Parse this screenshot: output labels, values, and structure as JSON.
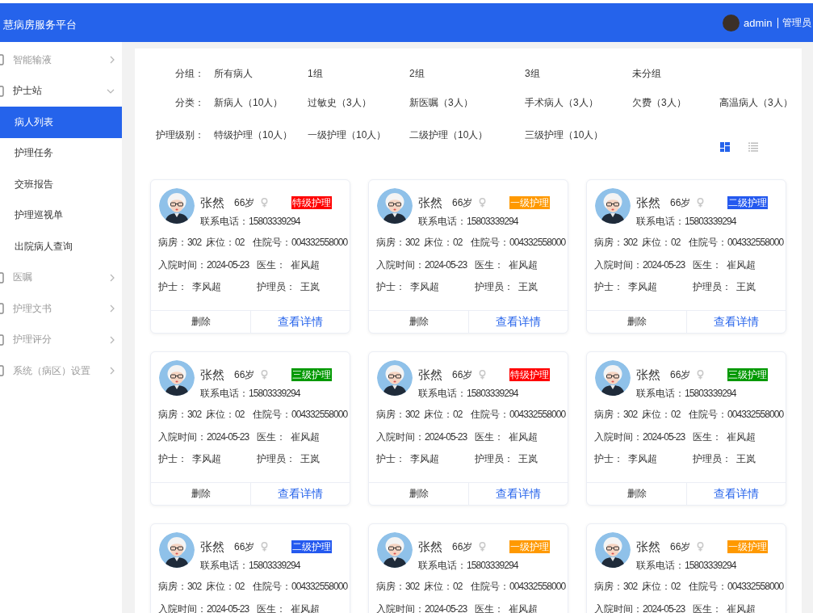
{
  "header": {
    "title": "慧病房服务平台",
    "user": "admin",
    "role": "管理员"
  },
  "sidebar": {
    "items": [
      {
        "label": "智能输液",
        "expanded": false
      },
      {
        "label": "护士站",
        "expanded": true,
        "children": [
          {
            "label": "病人列表",
            "selected": true
          },
          {
            "label": "护理任务",
            "selected": false
          },
          {
            "label": "交班报告",
            "selected": false
          },
          {
            "label": "护理巡视单",
            "selected": false
          },
          {
            "label": "出院病人查询",
            "selected": false
          }
        ]
      },
      {
        "label": "医嘱",
        "expanded": false
      },
      {
        "label": "护理文书",
        "expanded": false
      },
      {
        "label": "护理评分",
        "expanded": false
      },
      {
        "label": "系统（病区）设置",
        "expanded": false
      }
    ]
  },
  "filters": [
    {
      "label": "分组：",
      "options": [
        "所有病人",
        "1组",
        "2组",
        "3组",
        "未分组"
      ]
    },
    {
      "label": "分类：",
      "options": [
        "新病人（10人）",
        "过敏史（3人）",
        "新医嘱（3人）",
        "手术病人（3人）",
        "欠费（3人）",
        "高温病人（3人）"
      ]
    },
    {
      "label": "护理级别：",
      "options": [
        "特级护理（10人）",
        "一级护理（10人）",
        "二级护理（10人）",
        "三级护理（10人）"
      ]
    }
  ],
  "view_toggle": [
    {
      "kind": "grid",
      "selected": true
    },
    {
      "kind": "list",
      "selected": false
    }
  ],
  "cards": [
    {
      "name": "张然",
      "age": "66岁",
      "level": "特级护理",
      "color": "#ff0000",
      "phone": {
        "label": "联系电话：",
        "value": "15803339294"
      },
      "room": {
        "label": "病房：",
        "value": "302"
      },
      "bed": {
        "label": "床位：",
        "value": "02"
      },
      "admission_no": {
        "label": "住院号：",
        "value": "004332558000"
      },
      "admission_date": {
        "label": "入院时间：",
        "value": "2024-05-23"
      },
      "doctor": {
        "label": "医生：",
        "value": "崔风超"
      },
      "nurse": {
        "label": "护士：",
        "value": "李风超"
      },
      "caregiver": {
        "label": "护理员：",
        "value": "王岚"
      },
      "buttons": [
        {
          "label": "删除",
          "kind": "delete"
        },
        {
          "label": "查看详情",
          "kind": "details"
        }
      ]
    },
    {
      "name": "张然",
      "age": "66岁",
      "level": "一级护理",
      "color": "#ff9900",
      "phone": {
        "label": "联系电话：",
        "value": "15803339294"
      },
      "room": {
        "label": "病房：",
        "value": "302"
      },
      "bed": {
        "label": "床位：",
        "value": "02"
      },
      "admission_no": {
        "label": "住院号：",
        "value": "004332558000"
      },
      "admission_date": {
        "label": "入院时间：",
        "value": "2024-05-23"
      },
      "doctor": {
        "label": "医生：",
        "value": "崔风超"
      },
      "nurse": {
        "label": "护士：",
        "value": "李风超"
      },
      "caregiver": {
        "label": "护理员：",
        "value": "王岚"
      },
      "buttons": [
        {
          "label": "删除",
          "kind": "delete"
        },
        {
          "label": "查看详情",
          "kind": "details"
        }
      ]
    },
    {
      "name": "张然",
      "age": "66岁",
      "level": "二级护理",
      "color": "#2459ef",
      "phone": {
        "label": "联系电话：",
        "value": "15803339294"
      },
      "room": {
        "label": "病房：",
        "value": "302"
      },
      "bed": {
        "label": "床位：",
        "value": "02"
      },
      "admission_no": {
        "label": "住院号：",
        "value": "004332558000"
      },
      "admission_date": {
        "label": "入院时间：",
        "value": "2024-05-23"
      },
      "doctor": {
        "label": "医生：",
        "value": "崔风超"
      },
      "nurse": {
        "label": "护士：",
        "value": "李风超"
      },
      "caregiver": {
        "label": "护理员：",
        "value": "王岚"
      },
      "buttons": [
        {
          "label": "删除",
          "kind": "delete"
        },
        {
          "label": "查看详情",
          "kind": "details"
        }
      ]
    },
    {
      "name": "张然",
      "age": "66岁",
      "level": "三级护理",
      "color": "#009900",
      "phone": {
        "label": "联系电话：",
        "value": "15803339294"
      },
      "room": {
        "label": "病房：",
        "value": "302"
      },
      "bed": {
        "label": "床位：",
        "value": "02"
      },
      "admission_no": {
        "label": "住院号：",
        "value": "004332558000"
      },
      "admission_date": {
        "label": "入院时间：",
        "value": "2024-05-23"
      },
      "doctor": {
        "label": "医生：",
        "value": "崔风超"
      },
      "nurse": {
        "label": "护士：",
        "value": "李风超"
      },
      "caregiver": {
        "label": "护理员：",
        "value": "王岚"
      },
      "buttons": [
        {
          "label": "删除",
          "kind": "delete"
        },
        {
          "label": "查看详情",
          "kind": "details"
        }
      ]
    },
    {
      "name": "张然",
      "age": "66岁",
      "level": "特级护理",
      "color": "#ff0000",
      "phone": {
        "label": "联系电话：",
        "value": "15803339294"
      },
      "room": {
        "label": "病房：",
        "value": "302"
      },
      "bed": {
        "label": "床位：",
        "value": "02"
      },
      "admission_no": {
        "label": "住院号：",
        "value": "004332558000"
      },
      "admission_date": {
        "label": "入院时间：",
        "value": "2024-05-23"
      },
      "doctor": {
        "label": "医生：",
        "value": "崔风超"
      },
      "nurse": {
        "label": "护士：",
        "value": "李风超"
      },
      "caregiver": {
        "label": "护理员：",
        "value": "王岚"
      },
      "buttons": [
        {
          "label": "删除",
          "kind": "delete"
        },
        {
          "label": "查看详情",
          "kind": "details"
        }
      ]
    },
    {
      "name": "张然",
      "age": "66岁",
      "level": "三级护理",
      "color": "#009900",
      "phone": {
        "label": "联系电话：",
        "value": "15803339294"
      },
      "room": {
        "label": "病房：",
        "value": "302"
      },
      "bed": {
        "label": "床位：",
        "value": "02"
      },
      "admission_no": {
        "label": "住院号：",
        "value": "004332558000"
      },
      "admission_date": {
        "label": "入院时间：",
        "value": "2024-05-23"
      },
      "doctor": {
        "label": "医生：",
        "value": "崔风超"
      },
      "nurse": {
        "label": "护士：",
        "value": "李风超"
      },
      "caregiver": {
        "label": "护理员：",
        "value": "王岚"
      },
      "buttons": [
        {
          "label": "删除",
          "kind": "delete"
        },
        {
          "label": "查看详情",
          "kind": "details"
        }
      ]
    },
    {
      "name": "张然",
      "age": "66岁",
      "level": "二级护理",
      "color": "#2459ef",
      "phone": {
        "label": "联系电话：",
        "value": "15803339294"
      },
      "room": {
        "label": "病房：",
        "value": "302"
      },
      "bed": {
        "label": "床位：",
        "value": "02"
      },
      "admission_no": {
        "label": "住院号：",
        "value": "004332558000"
      },
      "admission_date": {
        "label": "入院时间：",
        "value": "2024-05-23"
      },
      "doctor": {
        "label": "医生：",
        "value": "崔风超"
      }
    },
    {
      "name": "张然",
      "age": "66岁",
      "level": "一级护理",
      "color": "#ff9900",
      "phone": {
        "label": "联系电话：",
        "value": "15803339294"
      },
      "room": {
        "label": "病房：",
        "value": "302"
      },
      "bed": {
        "label": "床位：",
        "value": "02"
      },
      "admission_no": {
        "label": "住院号：",
        "value": "004332558000"
      },
      "admission_date": {
        "label": "入院时间：",
        "value": "2024-05-23"
      },
      "doctor": {
        "label": "医生：",
        "value": "崔风超"
      }
    },
    {
      "name": "张然",
      "age": "66岁",
      "level": "一级护理",
      "color": "#ff9900",
      "phone": {
        "label": "联系电话：",
        "value": "15803339294"
      },
      "room": {
        "label": "病房：",
        "value": "302"
      },
      "bed": {
        "label": "床位：",
        "value": "02"
      },
      "admission_no": {
        "label": "住院号：",
        "value": "004332558000"
      },
      "admission_date": {
        "label": "入院时间：",
        "value": "2024-05-23"
      },
      "doctor": {
        "label": "医生：",
        "value": "崔风超"
      }
    }
  ]
}
